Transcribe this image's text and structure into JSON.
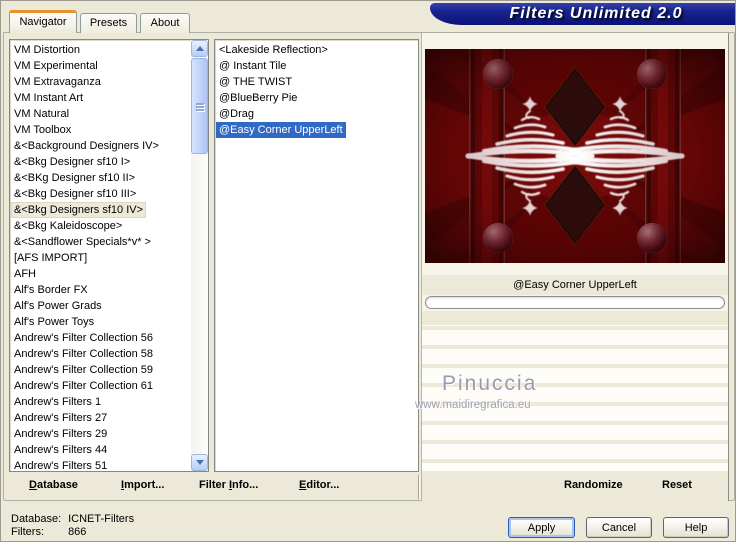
{
  "window": {
    "title": "Filters Unlimited 2.0"
  },
  "tabs": {
    "navigator": "Navigator",
    "presets": "Presets",
    "about": "About"
  },
  "category_list": {
    "selected_index": 10,
    "items": [
      "VM Distortion",
      "VM Experimental",
      "VM Extravaganza",
      "VM Instant Art",
      "VM Natural",
      "VM Toolbox",
      "&<Background Designers IV>",
      "&<Bkg Designer sf10 I>",
      "&<BKg Designer sf10 II>",
      "&<Bkg Designer sf10 III>",
      "&<Bkg Designers sf10 IV>",
      "&<Bkg Kaleidoscope>",
      "&<Sandflower Specials*v* >",
      "[AFS IMPORT]",
      "AFH",
      "Alf's Border FX",
      "Alf's Power Grads",
      "Alf's Power Toys",
      "Andrew's Filter Collection 56",
      "Andrew's Filter Collection 58",
      "Andrew's Filter Collection 59",
      "Andrew's Filter Collection 61",
      "Andrew's Filters 1",
      "Andrew's Filters 27",
      "Andrew's Filters 29",
      "Andrew's Filters 44",
      "Andrew's Filters 51"
    ]
  },
  "filter_list": {
    "selected_index": 5,
    "items": [
      "<Lakeside Reflection>",
      "@ Instant Tile",
      "@ THE TWIST",
      "@BlueBerry Pie",
      "@Drag",
      "@Easy Corner UpperLeft"
    ]
  },
  "preview": {
    "caption": "@Easy Corner UpperLeft",
    "watermark_name": "Pinuccia",
    "watermark_site": "www.maidiregrafica.eu"
  },
  "toolbar": {
    "database_key": "D",
    "database_rest": "atabase",
    "import_key": "I",
    "import_rest": "mport...",
    "filter_info_pre": "Filter ",
    "filter_info_key": "I",
    "filter_info_rest": "nfo...",
    "editor_key": "E",
    "editor_rest": "ditor...",
    "randomize": "Randomize",
    "reset": "Reset"
  },
  "status": {
    "database_label": "Database:",
    "database_value": "ICNET-Filters",
    "filters_label": "Filters:",
    "filters_value": "866"
  },
  "actions": {
    "apply": "Apply",
    "cancel": "Cancel",
    "help": "Help"
  },
  "colors": {
    "selection": "#316AC5",
    "banner": "#101B82",
    "tab_accent": "#E9932F",
    "dialog_bg": "#ECE9D8"
  }
}
